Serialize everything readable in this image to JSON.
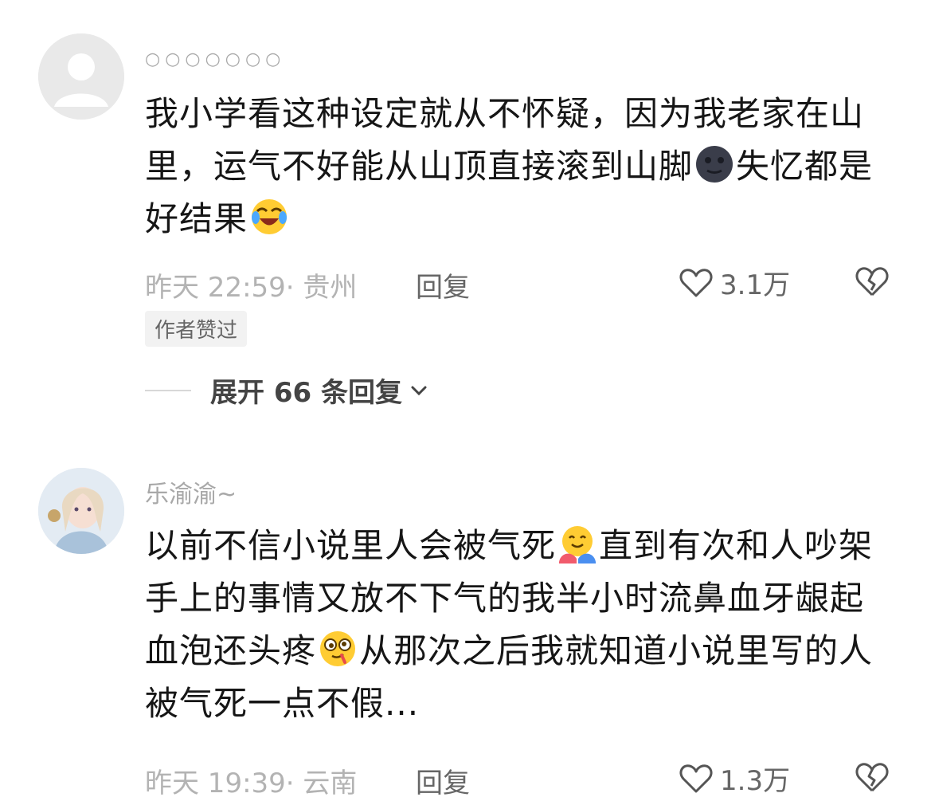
{
  "comments": [
    {
      "username": "○○○○○○○",
      "body_parts": [
        "我小学看这种设定就从不怀疑，因为我老家在山里，运气不好能从山顶直接滚到山脚",
        "失忆都是好结果"
      ],
      "emojis": [
        "dark-moon-face-icon",
        "laughing-crying-face-icon"
      ],
      "time_location": "昨天 22:59· 贵州",
      "reply_label": "回复",
      "like_count": "3.1万",
      "badge": "作者赞过",
      "expand_label": "展开 66 条回复"
    },
    {
      "username": "乐渝渝~",
      "body_parts": [
        "以前不信小说里人会被气死",
        "直到有次和人吵架手上的事情又放不下气的我半小时流鼻血牙龈起血泡还头疼",
        "从那次之后我就知道小说里写的人被气死一点不假..."
      ],
      "emojis": [
        "hugging-face-icon",
        "dizzy-face-icon"
      ],
      "time_location": "昨天 19:39· 云南",
      "reply_label": "回复",
      "like_count": "1.3万"
    }
  ],
  "colors": {
    "meta": "#b3b3b3",
    "text": "#161616",
    "badge_bg": "#f2f2f2"
  }
}
